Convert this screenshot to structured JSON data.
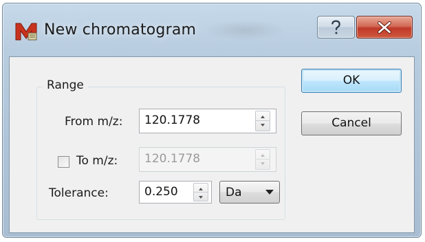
{
  "window": {
    "title": "New chromatogram",
    "icon": "app-m-icon",
    "help_icon": "question-mark-icon",
    "close_icon": "x-close-icon"
  },
  "range": {
    "group_title": "Range",
    "from": {
      "label": "From m/z:",
      "value": "120.1778",
      "enabled": true
    },
    "to": {
      "label": "To m/z:",
      "value": "120.1778",
      "checked": false,
      "enabled": false
    },
    "tolerance": {
      "label": "Tolerance:",
      "value": "0.250",
      "unit": "Da"
    }
  },
  "buttons": {
    "ok": "OK",
    "cancel": "Cancel"
  },
  "colors": {
    "close_button": "#c0392a",
    "default_button_border": "#3c7fb1",
    "app_icon": "#c8321e"
  }
}
